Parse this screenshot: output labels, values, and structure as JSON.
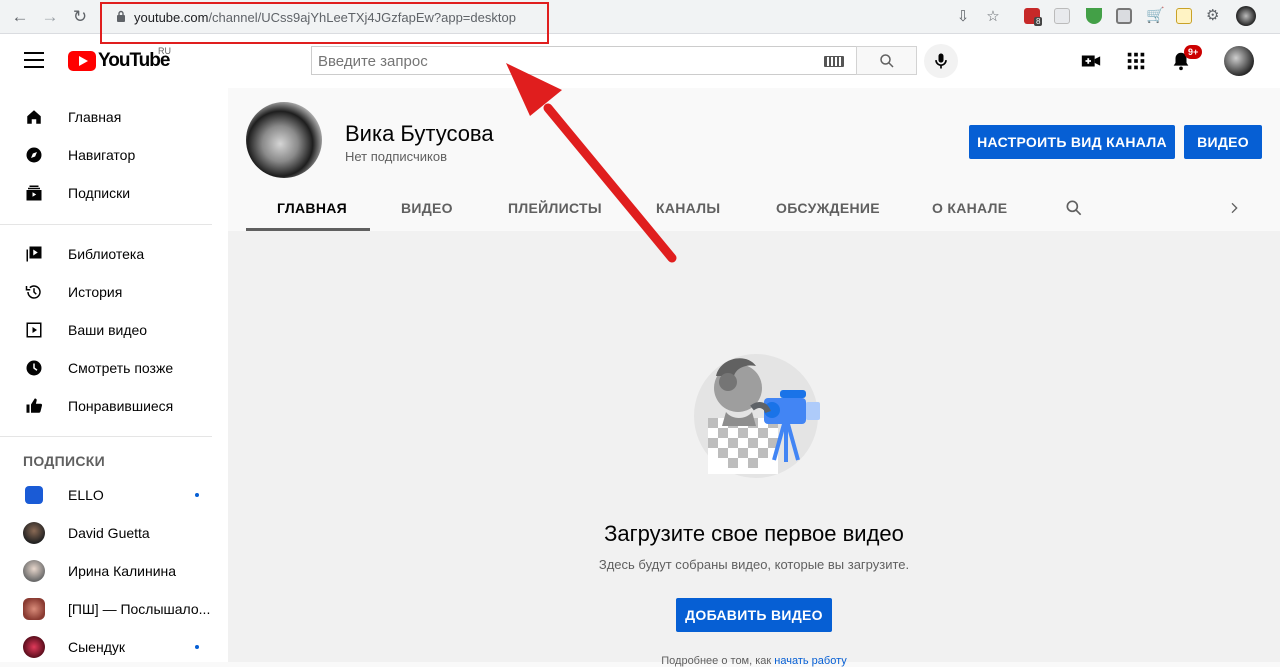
{
  "browser": {
    "url_host": "youtube.com",
    "url_path": "/channel/UCss9ajYhLeeTXj4JGzfapEw?app=desktop",
    "ext_badge": "8"
  },
  "masthead": {
    "logo_text": "YouTube",
    "logo_region": "RU",
    "search_placeholder": "Введите запрос",
    "notifications_badge": "9+"
  },
  "sidebar": {
    "main": [
      {
        "label": "Главная",
        "icon": "home-icon"
      },
      {
        "label": "Навигатор",
        "icon": "compass-icon"
      },
      {
        "label": "Подписки",
        "icon": "subscriptions-icon"
      }
    ],
    "library": [
      {
        "label": "Библиотека",
        "icon": "library-icon"
      },
      {
        "label": "История",
        "icon": "history-icon"
      },
      {
        "label": "Ваши видео",
        "icon": "your-videos-icon"
      },
      {
        "label": "Смотреть позже",
        "icon": "watch-later-icon"
      },
      {
        "label": "Понравившиеся",
        "icon": "like-icon"
      }
    ],
    "subs_heading": "ПОДПИСКИ",
    "subscriptions": [
      {
        "label": "ELLO",
        "live": true,
        "color": "#1a5bd6"
      },
      {
        "label": "David Guetta",
        "live": false,
        "color": "#333333"
      },
      {
        "label": "Ирина Калинина",
        "live": false,
        "color": "#8a8a8a"
      },
      {
        "label": "[ПШ] — Послышало...",
        "live": false,
        "color": "#b0413e"
      },
      {
        "label": "Сыендук",
        "live": true,
        "color": "#9b1b30"
      }
    ]
  },
  "channel": {
    "name": "Вика Бутусова",
    "subscribers": "Нет подписчиков",
    "customize_button": "НАСТРОИТЬ ВИД КАНАЛА",
    "videos_button": "ВИДЕО",
    "tabs": [
      "ГЛАВНАЯ",
      "ВИДЕО",
      "ПЛЕЙЛИСТЫ",
      "КАНАЛЫ",
      "ОБСУЖДЕНИЕ",
      "О КАНАЛЕ"
    ]
  },
  "empty_state": {
    "title": "Загрузите свое первое видео",
    "subtitle": "Здесь будут собраны видео, которые вы загрузите.",
    "add_button": "ДОБАВИТЬ ВИДЕО",
    "footnote_prefix": "Подробнее о том, как ",
    "footnote_link": "начать работу"
  },
  "colors": {
    "accent_blue": "#065fd4",
    "annotation_red": "#e01e1e",
    "youtube_red": "#ff0000"
  }
}
